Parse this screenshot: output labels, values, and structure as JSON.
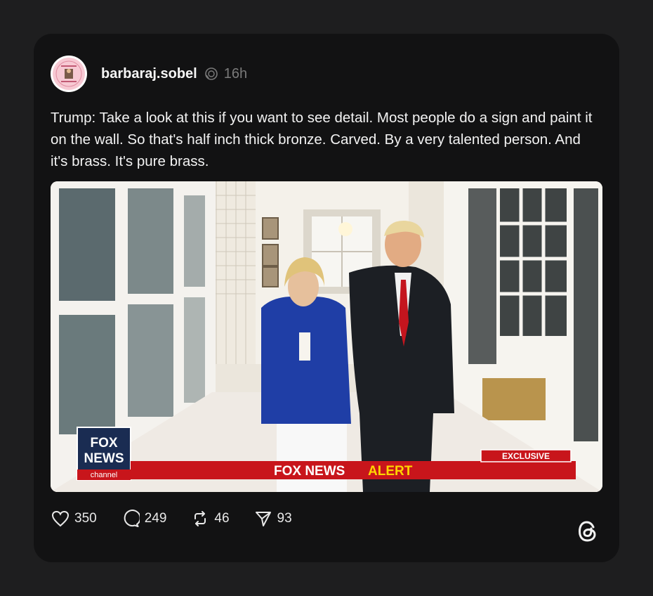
{
  "post": {
    "username": "barbaraj.sobel",
    "time": "16h",
    "text": "Trump: Take a look at this if you want to see detail. Most people do a sign and paint it on the wall. So that's half inch thick bronze. Carved. By a very talented person. And it's brass. It's pure brass."
  },
  "video": {
    "logo_line1": "FOX",
    "logo_line2": "NEWS",
    "logo_line3": "channel",
    "banner_fox_news": "FOX NEWS",
    "banner_alert": "ALERT",
    "exclusive_tag": "EXCLUSIVE"
  },
  "actions": {
    "likes": "350",
    "comments": "249",
    "reposts": "46",
    "shares": "93"
  },
  "icons": {
    "like": "heart-icon",
    "comment": "comment-icon",
    "repost": "repost-icon",
    "share": "send-icon",
    "brand": "threads-logo-icon",
    "verified": "verified-icon"
  },
  "colors": {
    "page_bg": "#1e1e1f",
    "card_bg": "#121213",
    "banner_red": "#c8151b",
    "alert_yellow": "#ffd400"
  }
}
